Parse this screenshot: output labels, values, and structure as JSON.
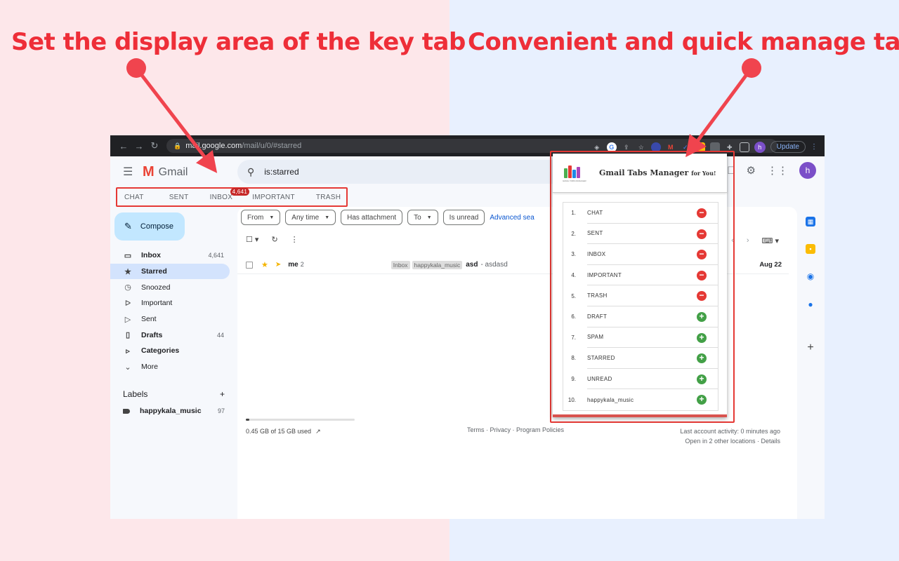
{
  "headlines": {
    "left": "Set the display area of the key tab",
    "right": "Convenient and quick manage tab"
  },
  "browser": {
    "url_host": "mail.google.com",
    "url_path": "/mail/u/0/#starred",
    "update_label": "Update",
    "profile_initial": "h"
  },
  "gmail": {
    "app_name": "Gmail",
    "search_value": "is:starred",
    "avatar_initial": "h",
    "key_tabs": [
      {
        "label": "CHAT"
      },
      {
        "label": "SENT"
      },
      {
        "label": "INBOX",
        "badge": "4,641"
      },
      {
        "label": "IMPORTANT"
      },
      {
        "label": "TRASH"
      }
    ],
    "compose_label": "Compose",
    "sidebar": [
      {
        "label": "Inbox",
        "count": "4,641",
        "icon": "inbox-icon"
      },
      {
        "label": "Starred",
        "count": "",
        "icon": "star-icon"
      },
      {
        "label": "Snoozed",
        "count": "",
        "icon": "clock-icon"
      },
      {
        "label": "Important",
        "count": "",
        "icon": "important-icon"
      },
      {
        "label": "Sent",
        "count": "",
        "icon": "send-icon"
      },
      {
        "label": "Drafts",
        "count": "44",
        "icon": "draft-icon"
      },
      {
        "label": "Categories",
        "count": "",
        "icon": "label-icon"
      },
      {
        "label": "More",
        "count": "",
        "icon": "chevron-down-icon"
      }
    ],
    "labels_heading": "Labels",
    "labels": [
      {
        "label": "happykala_music",
        "count": "97"
      }
    ],
    "filter_chips": [
      "From",
      "Any time",
      "Has attachment",
      "To",
      "Is unread"
    ],
    "advanced_search": "Advanced sea",
    "mail": {
      "from": "me",
      "thread_count": "2",
      "labels": [
        "Inbox",
        "happykala_music"
      ],
      "subject": "asd",
      "snippet": "- asdasd",
      "date": "Aug 22"
    },
    "storage": {
      "used_text": "0.45 GB of 15 GB used",
      "fraction": 0.03
    },
    "footer_links": "Terms · Privacy · Program Policies",
    "last_activity": "Last account activity: 0 minutes ago",
    "other_locations": "Open in 2 other locations · Details"
  },
  "popup": {
    "title": "Gmail Tabs Manager",
    "title_suffix": "for You!",
    "logo_caption": "GMAIL TABS MANAGER",
    "tabs": [
      {
        "num": "1.",
        "name": "CHAT",
        "action": "remove"
      },
      {
        "num": "2.",
        "name": "SENT",
        "action": "remove"
      },
      {
        "num": "3.",
        "name": "INBOX",
        "action": "remove"
      },
      {
        "num": "4.",
        "name": "IMPORTANT",
        "action": "remove"
      },
      {
        "num": "5.",
        "name": "TRASH",
        "action": "remove"
      },
      {
        "num": "6.",
        "name": "DRAFT",
        "action": "add"
      },
      {
        "num": "7.",
        "name": "SPAM",
        "action": "add"
      },
      {
        "num": "8.",
        "name": "STARRED",
        "action": "add"
      },
      {
        "num": "9.",
        "name": "UNREAD",
        "action": "add"
      },
      {
        "num": "10.",
        "name": "happykala_music",
        "action": "add"
      }
    ]
  },
  "colors": {
    "accent_red": "#ee2e38",
    "remove": "#e53935",
    "add": "#43a047"
  }
}
